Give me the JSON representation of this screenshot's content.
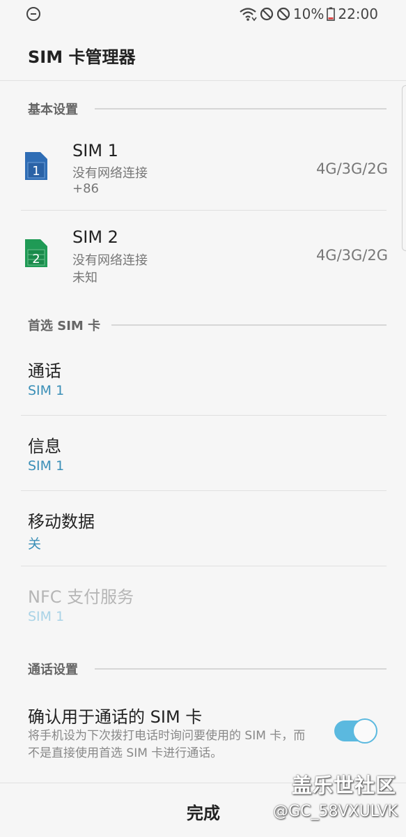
{
  "status_bar": {
    "battery": "10%",
    "time": "22:00"
  },
  "header": {
    "title": "SIM 卡管理器"
  },
  "sections": {
    "basic": "基本设置",
    "preferred": "首选 SIM 卡",
    "call_settings": "通话设置"
  },
  "sims": [
    {
      "icon_number": "1",
      "name": "SIM 1",
      "status": "没有网络连接",
      "number": "+86",
      "network": "4G/3G/2G",
      "color": "#2f6db5"
    },
    {
      "icon_number": "2",
      "name": "SIM 2",
      "status": "没有网络连接",
      "number": "未知",
      "network": "4G/3G/2G",
      "color": "#1f9a55"
    }
  ],
  "preferred": [
    {
      "title": "通话",
      "value": "SIM 1"
    },
    {
      "title": "信息",
      "value": "SIM 1"
    },
    {
      "title": "移动数据",
      "value": "关"
    },
    {
      "title": "NFC 支付服务",
      "value": "SIM 1"
    }
  ],
  "call_settings": {
    "confirm_title": "确认用于通话的 SIM 卡",
    "confirm_desc": "将手机设为下次拨打电话时询问要使用的 SIM 卡，而不是直接使用首选 SIM 卡进行通话。",
    "confirm_enabled": true
  },
  "bottom": {
    "done_label": "完成",
    "watermark_title": "盖乐世社区",
    "watermark_user": "@GC_58VXULVK"
  },
  "colors": {
    "accent": "#3a8fb7",
    "toggle": "#5bb9df"
  }
}
